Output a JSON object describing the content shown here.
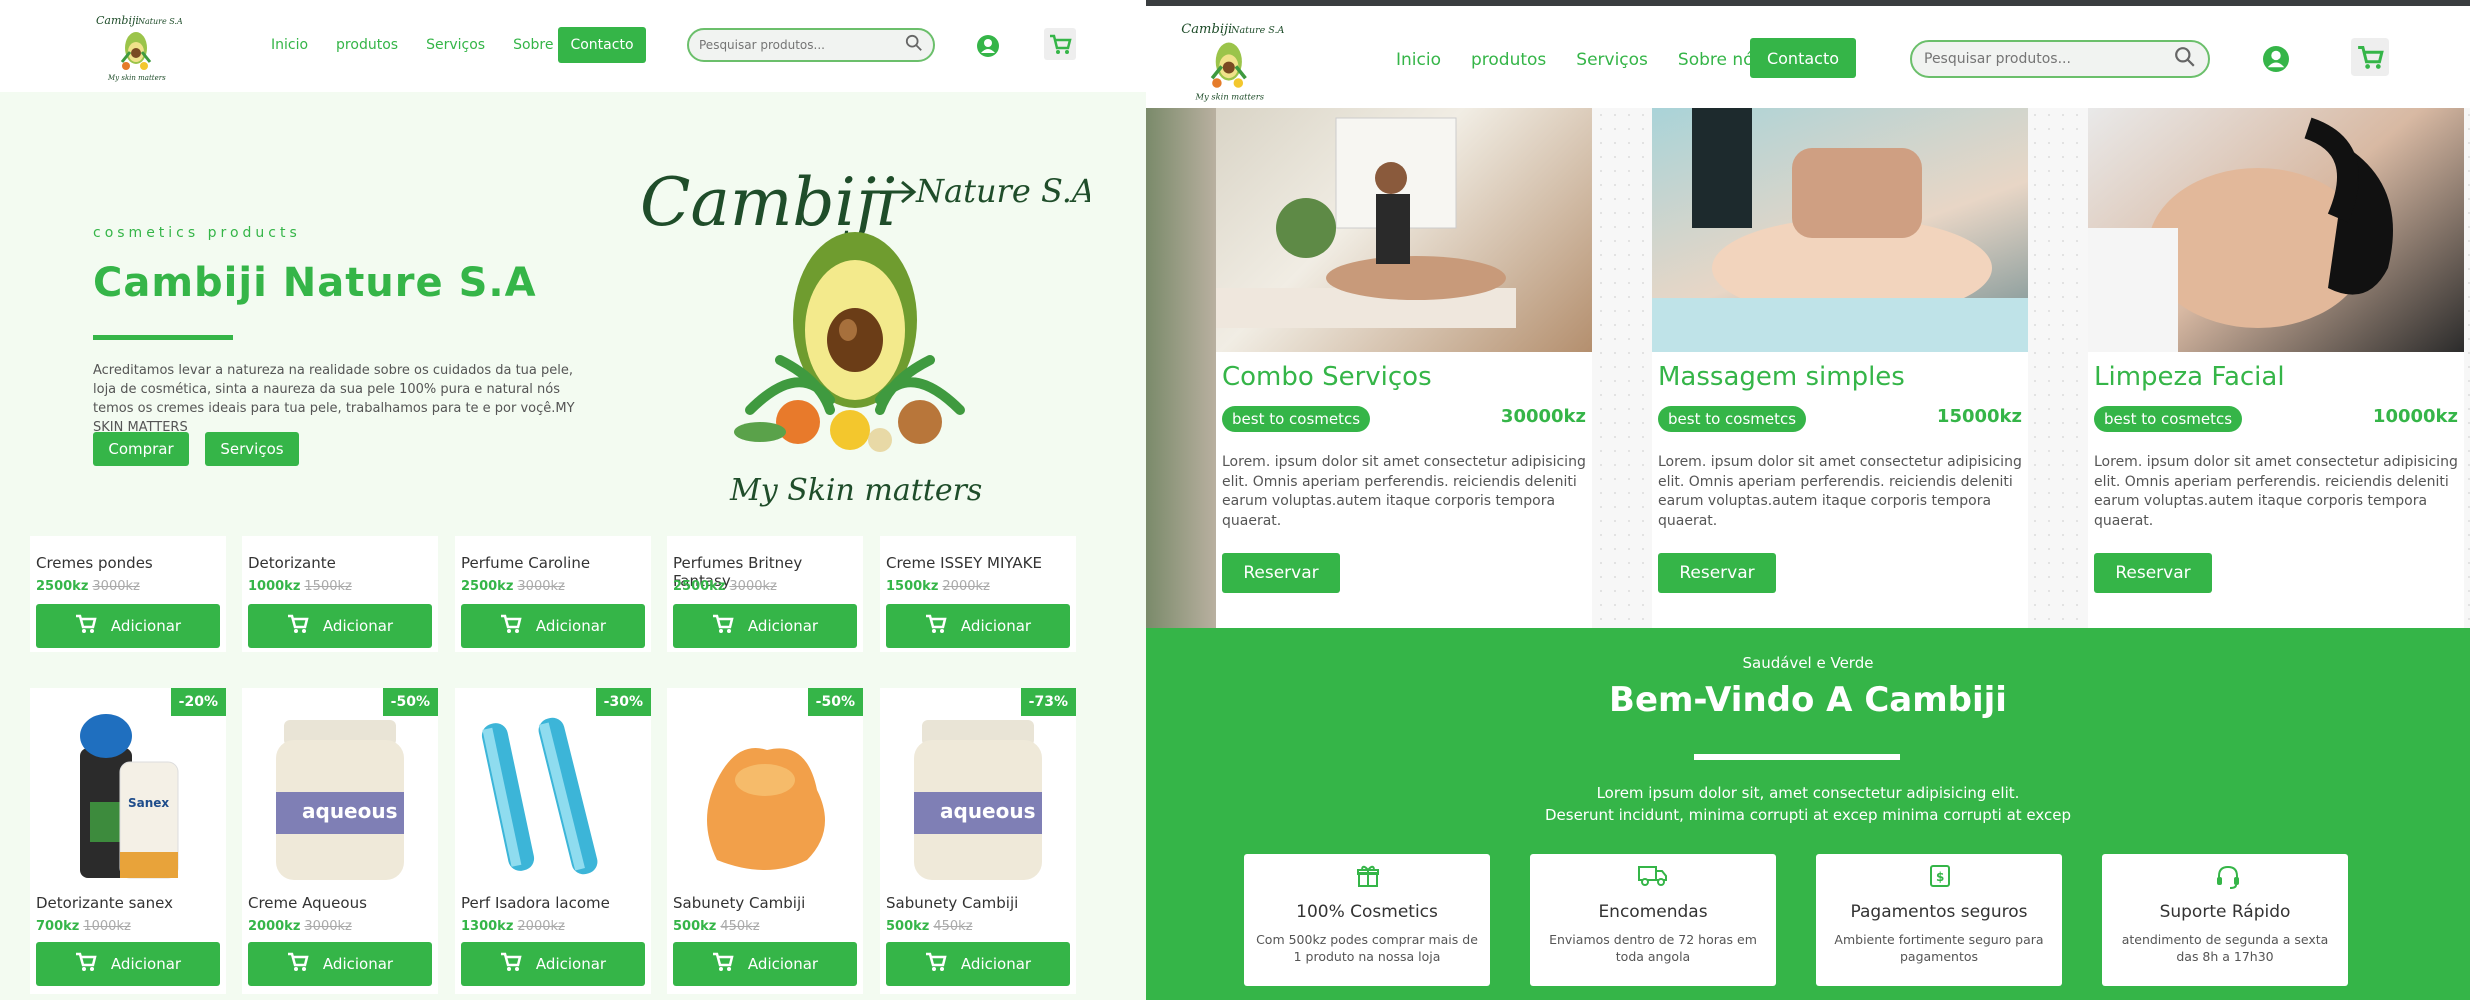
{
  "brand": {
    "logo_script": "Cambiji Nature S.A",
    "logo_sub": "My Skin matters",
    "accent": "#35b548"
  },
  "nav": {
    "items": [
      "Inicio",
      "produtos",
      "Serviços",
      "Sobre nós"
    ],
    "contact": "Contacto"
  },
  "search": {
    "placeholder": "Pesquisar produtos..."
  },
  "hero": {
    "tag": "cosmetics products",
    "title": "Cambiji Nature S.A",
    "text": "Acreditamos levar a natureza na realidade sobre os cuidados da tua pele, loja de cosmética, sinta a naureza da sua pele 100% pura e natural nós temos os cremes ideais para tua pele, trabalhamos para te e por voçê.MY SKIN MATTERS",
    "buy_label": "Comprar",
    "services_label": "Serviços",
    "art_title": "Cambiji",
    "art_title2": "Nature S.A",
    "art_sub": "My Skin matters"
  },
  "products_row1": [
    {
      "name": "Cremes pondes",
      "price": "2500kz",
      "old": "3000kz",
      "add": "Adicionar"
    },
    {
      "name": "Detorizante",
      "price": "1000kz",
      "old": "1500kz",
      "add": "Adicionar"
    },
    {
      "name": "Perfume Caroline",
      "price": "2500kz",
      "old": "3000kz",
      "add": "Adicionar"
    },
    {
      "name": "Perfumes Britney Fantasy",
      "price": "2500kz",
      "old": "3000kz",
      "add": "Adicionar"
    },
    {
      "name": "Creme ISSEY MIYAKE",
      "price": "1500kz",
      "old": "2000kz",
      "add": "Adicionar"
    }
  ],
  "products_row2": [
    {
      "name": "Detorizante sanex",
      "price": "700kz",
      "old": "1000kz",
      "badge": "-20%",
      "add": "Adicionar",
      "label": "Sanex"
    },
    {
      "name": "Creme Aqueous",
      "price": "2000kz",
      "old": "3000kz",
      "badge": "-50%",
      "add": "Adicionar",
      "label": "aqueous"
    },
    {
      "name": "Perf Isadora lacome",
      "price": "1300kz",
      "old": "2000kz",
      "badge": "-30%",
      "add": "Adicionar"
    },
    {
      "name": "Sabunety Cambiji",
      "price": "500kz",
      "old": "450kz",
      "badge": "-50%",
      "add": "Adicionar"
    },
    {
      "name": "Sabunety Cambiji",
      "price": "500kz",
      "old": "450kz",
      "badge": "-73%",
      "add": "Adicionar",
      "label": "aqueous"
    }
  ],
  "services": [
    {
      "title": "Combo Serviços",
      "pill": "best to cosmetcs",
      "price": "30000kz",
      "desc": "Lorem. ipsum dolor sit amet consectetur adipisicing elit. Omnis aperiam perferendis. reiciendis deleniti earum voluptas.autem itaque corporis tempora quaerat.",
      "button": "Reservar"
    },
    {
      "title": "Massagem simples",
      "pill": "best to cosmetcs",
      "price": "15000kz",
      "desc": "Lorem. ipsum dolor sit amet consectetur adipisicing elit. Omnis aperiam perferendis. reiciendis deleniti earum voluptas.autem itaque corporis tempora quaerat.",
      "button": "Reservar"
    },
    {
      "title": "Limpeza Facial",
      "pill": "best to cosmetcs",
      "price": "10000kz",
      "desc": "Lorem. ipsum dolor sit amet consectetur adipisicing elit. Omnis aperiam perferendis. reiciendis deleniti earum voluptas.autem itaque corporis tempora quaerat.",
      "button": "Reservar"
    }
  ],
  "welcome": {
    "sub": "Saudável e Verde",
    "title": "Bem-Vindo A Cambiji",
    "text1": "Lorem ipsum dolor sit, amet consectetur adipisicing elit.",
    "text2": "Deserunt incidunt, minima corrupti at excep minima corrupti at excep"
  },
  "features": [
    {
      "icon": "gift-icon",
      "title": "100% Cosmetics",
      "desc": "Com 500kz podes comprar mais de 1 produto na nossa loja"
    },
    {
      "icon": "truck-icon",
      "title": "Encomendas",
      "desc": "Enviamos dentro de 72 horas em toda angola"
    },
    {
      "icon": "money-icon",
      "title": "Pagamentos seguros",
      "desc": "Ambiente fortimente seguro para pagamentos"
    },
    {
      "icon": "headset-icon",
      "title": "Suporte Rápido",
      "desc": "atendimento de segunda a sexta das 8h a 17h30"
    }
  ]
}
